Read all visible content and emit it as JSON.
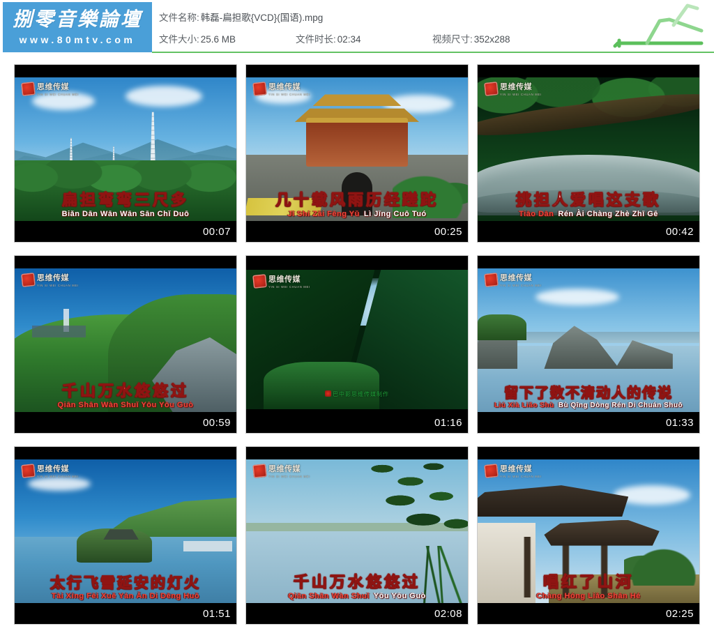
{
  "brand": {
    "name_cn": "捌零音樂論壇",
    "url": "www.80mtv.com",
    "bg_color": "#4a9fd8"
  },
  "file_info": {
    "name_label": "文件名称:",
    "name_value": "韩磊-扁担歌{VCD}(国语).mpg",
    "size_label": "文件大小:",
    "size_value": "25.6 MB",
    "duration_label": "文件时长:",
    "duration_value": "02:34",
    "dimension_label": "视频尺寸:",
    "dimension_value": "352x288"
  },
  "accent": {
    "rule_color": "#63c263",
    "deco_color": "#7fce7f",
    "subtitle_highlight": "#f0463a"
  },
  "watermark": {
    "cn": "思维传媒",
    "pinyin": "YIN SI WEI CHUAN MEI"
  },
  "thumbnails": [
    {
      "index": 1,
      "timestamp": "00:07",
      "scene": "three-pagodas-blue-sky",
      "subtitle_cn": "扁担弯弯三尺多",
      "subtitle_pinyin": "Biǎn Dān Wān Wān Sān Chǐ Duō",
      "highlight_cn": "",
      "highlight_pinyin": ""
    },
    {
      "index": 2,
      "timestamp": "00:25",
      "scene": "ancient-city-gate-tower",
      "subtitle_cn": "几十载风雨历经蹉跎",
      "subtitle_pinyin": "Jǐ Shí Zǎi Fēng Yǔ Lì Jīng Cuō Tuó",
      "highlight_cn": "几十载风雨",
      "highlight_pinyin": "Jǐ Shí Zǎi Fēng Yǔ"
    },
    {
      "index": 3,
      "timestamp": "00:42",
      "scene": "stone-bridge-ancient-tree",
      "subtitle_cn": "挑担人爱唱这支歌",
      "subtitle_pinyin": "Tiāo Dān Rén Ài Chàng Zhè Zhī Gē",
      "highlight_cn": "挑担",
      "highlight_pinyin": "Tiāo Dān"
    },
    {
      "index": 4,
      "timestamp": "00:59",
      "scene": "green-hillside-cliff",
      "subtitle_cn": "千山万水悠悠过",
      "subtitle_pinyin": "Qiān Shān Wàn Shuǐ Yōu Yōu Guò",
      "highlight_cn": "千山万水悠悠过",
      "highlight_pinyin": "Qiān Shān Wàn Shuǐ Yōu Yōu Guò"
    },
    {
      "index": 5,
      "timestamp": "01:16",
      "scene": "deep-green-ravine",
      "subtitle_cn": "",
      "subtitle_pinyin": "",
      "highlight_cn": "",
      "highlight_pinyin": "",
      "credit": "巴中影思维传媒制作"
    },
    {
      "index": 6,
      "timestamp": "01:33",
      "scene": "lake-rock-islets",
      "subtitle_cn": "留下了数不清动人的传说",
      "subtitle_pinyin": "Liú Xià Liǎo Shù Bù Qīng Dòng Rén Di Chuán Shuō",
      "highlight_cn": "留下了数",
      "highlight_pinyin": "Liú Xià Liǎo Shù"
    },
    {
      "index": 7,
      "timestamp": "01:51",
      "scene": "lake-island-temple",
      "subtitle_cn": "太行飞雪延安的灯火",
      "subtitle_pinyin": "Tài Xíng Fēi Xuě Yán Ān Di Dēng Huǒ",
      "highlight_cn": "太行飞雪延安的灯火",
      "highlight_pinyin": "Tài Xíng Fēi Xuě Yán Ān Di Dēng Huǒ"
    },
    {
      "index": 8,
      "timestamp": "02:08",
      "scene": "lake-willow-branches",
      "subtitle_cn": "千山万水悠悠过",
      "subtitle_pinyin": "Qiān Shān Wàn Shuǐ Yōu Yōu Guò",
      "highlight_cn": "千山万水",
      "highlight_pinyin": "Qiān Shān Wàn Shuǐ"
    },
    {
      "index": 9,
      "timestamp": "02:25",
      "scene": "traditional-archway-gate",
      "subtitle_cn": "唱红了山河",
      "subtitle_pinyin": "Chàng Hóng Liǎo Shān Hé",
      "highlight_cn": "唱红了山河",
      "highlight_pinyin": "Chàng Hóng Liǎo Shān Hé"
    }
  ]
}
